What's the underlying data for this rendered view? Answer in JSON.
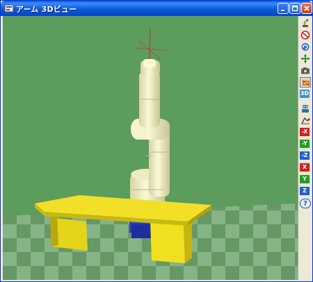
{
  "window": {
    "title": "アーム 3Dビュー",
    "accent": "#0a5bdc"
  },
  "titlebar_buttons": [
    {
      "name": "minimize",
      "icon": "minimize-icon"
    },
    {
      "name": "maximize",
      "icon": "maximize-icon"
    },
    {
      "name": "close",
      "icon": "close-icon"
    }
  ],
  "scene": {
    "background": "#5c9c5c",
    "floor_light": "#8fc08f",
    "floor_dark": "#6da26d",
    "robot_color": "#f2eec0",
    "table_color": "#f0e020",
    "base_color": "#2a3cc8"
  },
  "toolbar": {
    "buttons": [
      {
        "icon": "robot-arm-icon"
      },
      {
        "icon": "no-entry-icon"
      },
      {
        "icon": "rotate-view-icon"
      },
      {
        "icon": "move-view-icon"
      },
      {
        "icon": "camera-icon"
      },
      {
        "icon": "tool-hand-icon"
      },
      {
        "icon": "3d-view-icon",
        "label": "3D"
      },
      {
        "icon": "robot-icon"
      },
      {
        "icon": "teach-icon"
      },
      {
        "icon": "axis-x-icon",
        "label": "-X"
      },
      {
        "icon": "axis-y-icon",
        "label": "-Y"
      },
      {
        "icon": "axis-z-icon",
        "label": "-Z"
      },
      {
        "icon": "axis-x-icon",
        "label": "X"
      },
      {
        "icon": "axis-y-icon",
        "label": "Y"
      },
      {
        "icon": "axis-z-icon",
        "label": "Z"
      },
      {
        "icon": "help-icon",
        "label": "?"
      }
    ]
  }
}
